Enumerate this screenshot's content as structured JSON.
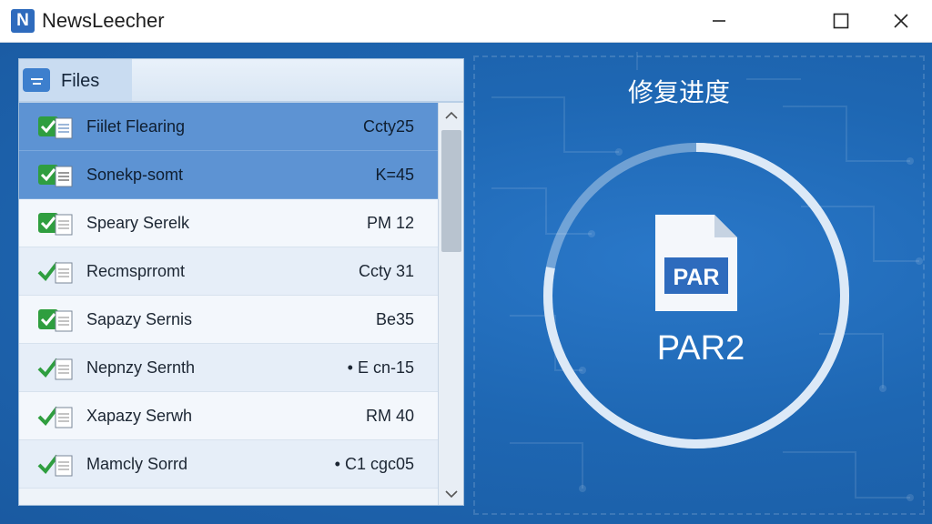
{
  "window": {
    "app_icon_letter": "N",
    "title": "NewsLeecher"
  },
  "file_panel": {
    "header_label": "Files",
    "rows": [
      {
        "name": "Fiilet Flearing",
        "value": "Ccty25",
        "state": "selected"
      },
      {
        "name": "Sonekp-somt",
        "value": "K=45",
        "state": "selected"
      },
      {
        "name": "Speary Serelk",
        "value": "PM 12",
        "state": "normal"
      },
      {
        "name": "Recmsprromt",
        "value": "Ccty 31",
        "state": "normal"
      },
      {
        "name": "Sapazy Sernis",
        "value": "Be35",
        "state": "normal"
      },
      {
        "name": "Nepnzy Sernth",
        "value": "• E cn-15",
        "state": "normal"
      },
      {
        "name": "Xapazy Serwh",
        "value": "RM 40",
        "state": "normal"
      },
      {
        "name": "Mamcly Sorrd",
        "value": "• C1 cgc05",
        "state": "normal"
      }
    ]
  },
  "repair": {
    "title": "修复进度",
    "file_badge": "PAR",
    "label": "PAR2",
    "progress": 0.78
  },
  "colors": {
    "accent": "#2e6bbd",
    "check_green": "#2f9e3f",
    "selection": "#5d93d3"
  }
}
